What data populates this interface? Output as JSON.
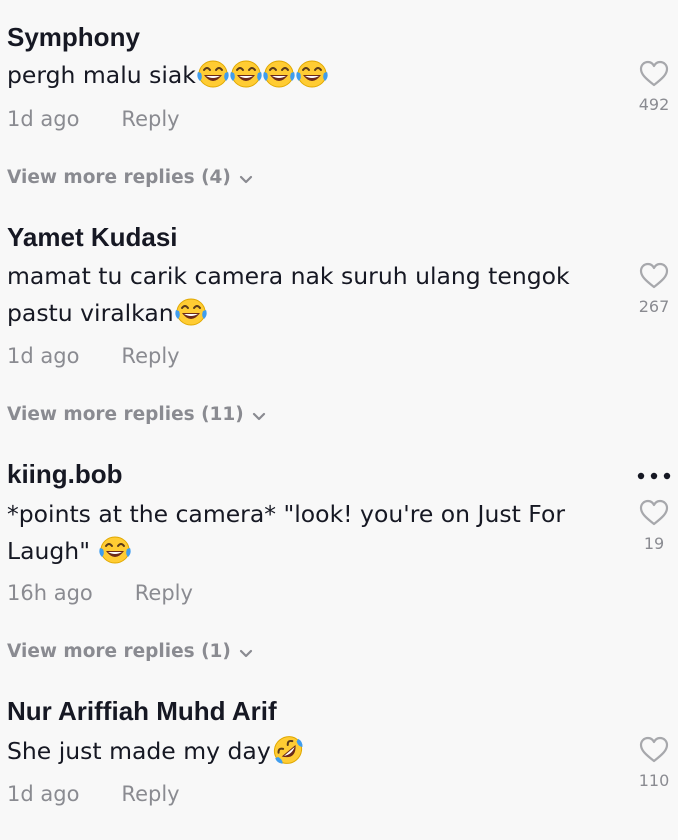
{
  "comments": [
    {
      "username": "Symphony",
      "text": "pergh malu siak",
      "emoji_count": 4,
      "time": "1d ago",
      "reply_label": "Reply",
      "likes": "492",
      "view_more": "View more replies (4)"
    },
    {
      "username": "Yamet Kudasi",
      "text_line1": "mamat tu carik camera nak suruh ulang tengok",
      "text_line2": "pastu viralkan",
      "emoji_count": 1,
      "time": "1d ago",
      "reply_label": "Reply",
      "likes": "267",
      "view_more": "View more replies (11)"
    },
    {
      "username": "kiing.bob",
      "text_line1": "*points at the camera* \"look! you're on Just For",
      "text_line2": "Laugh\"",
      "emoji_count": 1,
      "time": "16h ago",
      "reply_label": "Reply",
      "likes": "19",
      "view_more": "View more replies (1)"
    },
    {
      "username": "Nur Ariffiah Muhd Arif",
      "text": "She just made my day",
      "emoji_count": 1,
      "time": "1d ago",
      "reply_label": "Reply",
      "likes": "110"
    }
  ],
  "icons": {
    "heart": "heart-outline-icon",
    "more": "more-options-icon",
    "chevron": "chevron-down-icon",
    "emoji_laugh": "face-with-tears-of-joy-emoji",
    "emoji_rofl": "rolling-on-the-floor-laughing-emoji"
  },
  "colors": {
    "background": "#f8f8f8",
    "primary_text": "#161823",
    "secondary_text": "#8a8b91",
    "heart_stroke": "#a7a8ac",
    "emoji_yellow": "#ffcc33",
    "emoji_tears": "#3f9dee"
  }
}
